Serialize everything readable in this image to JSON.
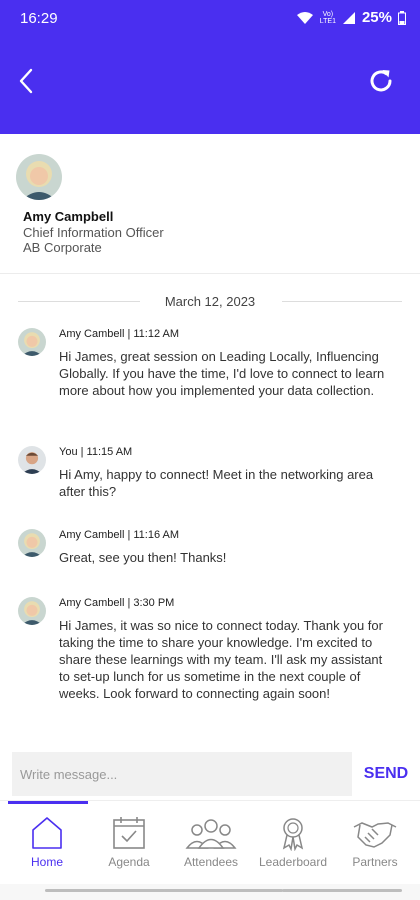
{
  "status_bar": {
    "time": "16:29",
    "network_top": "Vo)",
    "network_bottom": "LTE1",
    "battery": "25%"
  },
  "header": {
    "back_icon": "chevron-left-icon",
    "refresh_icon": "refresh-icon",
    "color": "#4a2ff0"
  },
  "contact": {
    "name": "Amy Campbell",
    "title": "Chief Information Officer",
    "company": "AB Corporate"
  },
  "conversation": {
    "date": "March 12, 2023",
    "messages": [
      {
        "meta": "Amy Cambell | 11:12 AM",
        "text": "Hi James, great session on Leading Locally, Influencing Globally. If you have the time, I'd love to connect to learn more about how you implemented your data collection."
      },
      {
        "meta": "You | 11:15 AM",
        "text": "Hi Amy, happy to connect! Meet in the networking area after this?"
      },
      {
        "meta": "Amy Cambell | 11:16 AM",
        "text": "Great, see you then! Thanks!"
      },
      {
        "meta": "Amy Cambell | 3:30 PM",
        "text": "Hi James, it was so nice to connect today. Thank you for taking the time to share your knowledge. I'm excited to share these learnings with my team. I'll ask my assistant to set-up lunch for us sometime in the next couple of weeks. Look forward to connecting again soon!"
      }
    ]
  },
  "composer": {
    "placeholder": "Write message...",
    "send_label": "SEND"
  },
  "tabs": [
    {
      "label": "Home",
      "icon": "home-icon",
      "active": true
    },
    {
      "label": "Agenda",
      "icon": "calendar-check-icon",
      "active": false
    },
    {
      "label": "Attendees",
      "icon": "people-icon",
      "active": false
    },
    {
      "label": "Leaderboard",
      "icon": "award-ribbon-icon",
      "active": false
    },
    {
      "label": "Partners",
      "icon": "handshake-icon",
      "active": false
    }
  ],
  "colors": {
    "accent": "#4a2ff0",
    "inactive_tab": "#888888"
  }
}
